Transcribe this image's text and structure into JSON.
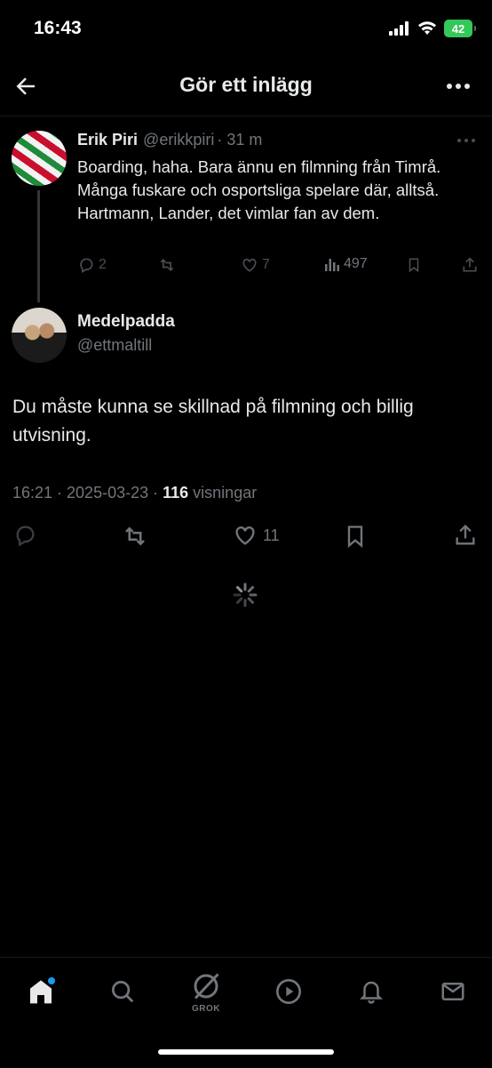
{
  "status_bar": {
    "time": "16:43",
    "battery": "42"
  },
  "header": {
    "title": "Gör ett inlägg"
  },
  "parent_tweet": {
    "name": "Erik Piri",
    "handle": "@erikkpiri",
    "time": "· 31 m",
    "text": "Boarding, haha. Bara ännu en filmning från Timrå. Många fuskare och osportsliga spelare där, alltså. Hartmann, Lander, det vimlar fan av dem.",
    "replies": "2",
    "likes": "7",
    "views": "497"
  },
  "main_tweet": {
    "name": "Medelpadda",
    "handle": "@ettmaltill",
    "text": "Du måste kunna se skillnad på filmning och billig utvisning.",
    "datetime": "16:21 · 2025-03-23 · ",
    "views_count": "116",
    "views_label": " visningar",
    "likes": "11"
  },
  "nav": {
    "grok_label": "GROK"
  },
  "icons": [
    "back-arrow-icon",
    "more-icon",
    "reply-icon",
    "retweet-icon",
    "heart-icon",
    "views-icon",
    "bookmark-icon",
    "share-icon",
    "home-icon",
    "search-icon",
    "grok-icon",
    "play-icon",
    "bell-icon",
    "mail-icon",
    "spinner-icon",
    "signal-icon",
    "wifi-icon"
  ],
  "colors": {
    "background": "#000000",
    "text": "#e7e9ea",
    "muted": "#71767b",
    "accent": "#1d9bf0",
    "battery": "#34c759"
  }
}
